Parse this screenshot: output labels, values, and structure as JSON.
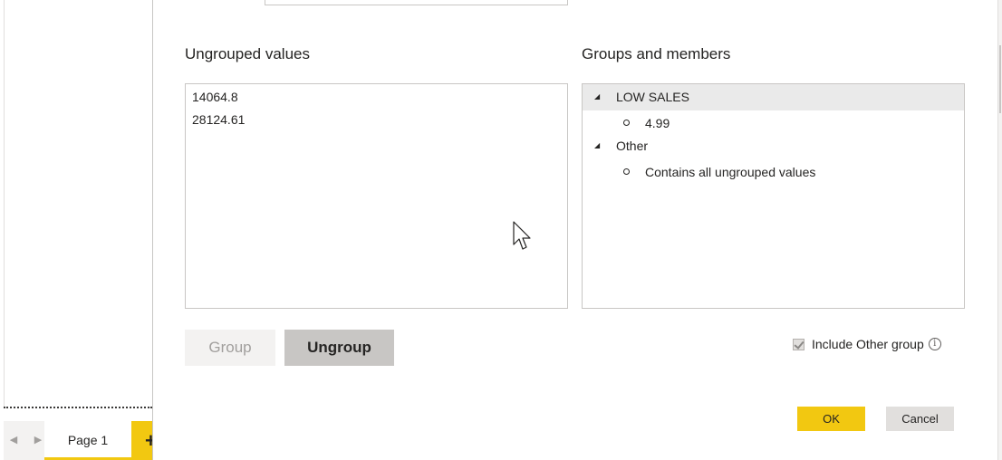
{
  "left_panel": {
    "page_tab_label": "Page 1",
    "add_page_glyph": "+",
    "prev_glyph": "◀",
    "next_glyph": "▶"
  },
  "dialog": {
    "ungrouped_title": "Ungrouped values",
    "ungrouped_values": [
      "14064.8",
      "28124.61"
    ],
    "groups_title": "Groups and members",
    "groups": [
      {
        "name": "LOW SALES",
        "selected": true,
        "members": [
          "4.99"
        ]
      },
      {
        "name": "Other",
        "selected": false,
        "members": [
          "Contains all ungrouped values"
        ]
      }
    ],
    "group_button": "Group",
    "ungroup_button": "Ungroup",
    "include_other_label": "Include Other group",
    "include_other_checked": true,
    "info_glyph": "i",
    "ok_button": "OK",
    "cancel_button": "Cancel"
  },
  "colors": {
    "accent": "#f2c811",
    "selected_row": "#eaeaea",
    "button_disabled_bg": "#f3f2f1",
    "button_active_bg": "#c8c6c4"
  }
}
